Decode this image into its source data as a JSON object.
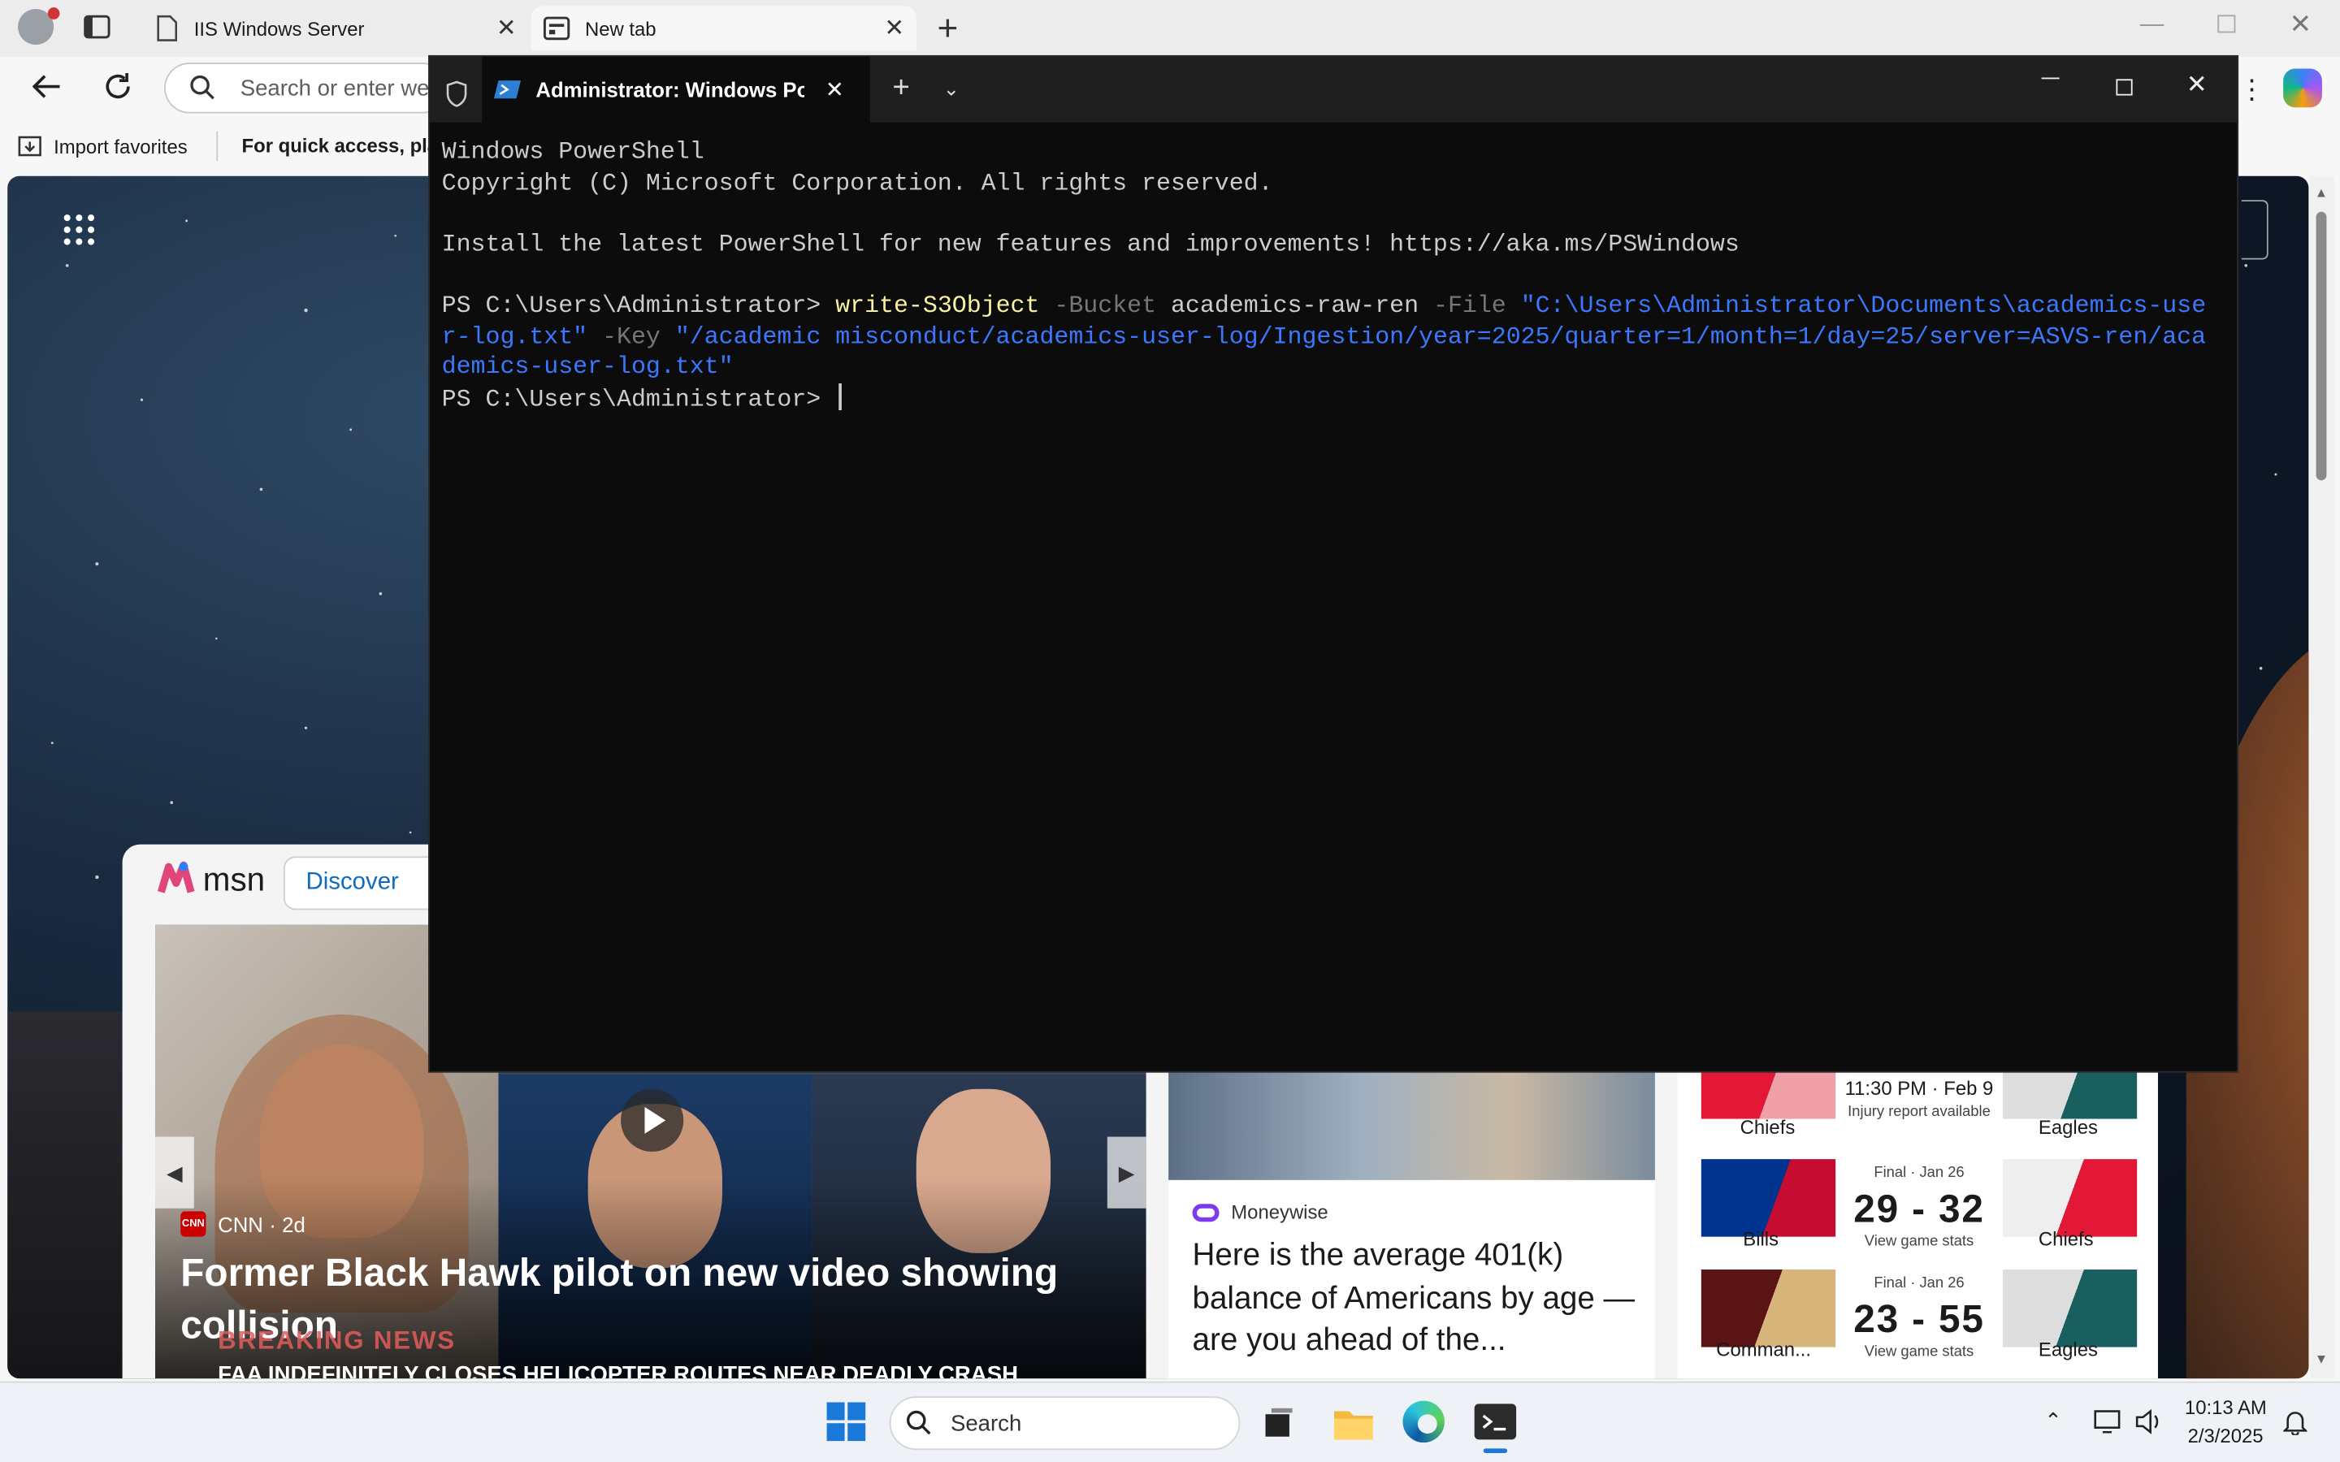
{
  "browser": {
    "tabs": [
      {
        "title": "IIS Windows Server"
      },
      {
        "title": "New tab"
      }
    ],
    "address_placeholder": "Search or enter web address",
    "favorites": {
      "import_label": "Import favorites",
      "tip": "For quick access, place your favorites here on the favorites bar."
    }
  },
  "msn": {
    "brand": "msn",
    "discover_label": "Discover",
    "main_story": {
      "source": "CNN",
      "age": "2d",
      "title": "Former Black Hawk pilot on new video showing collision",
      "banner": "BREAKING NEWS",
      "ticker": "FAA INDEFINITELY CLOSES HELICOPTER ROUTES NEAR DEADLY CRASH"
    },
    "side_story": {
      "source": "Moneywise",
      "title": "Here is the average 401(k) balance of Americans by age — are you ahead of the..."
    },
    "games": [
      {
        "left": "Chiefs",
        "right": "Eagles",
        "status": "11:30 PM · Feb 9",
        "detail": "Injury report available",
        "score": ""
      },
      {
        "left": "Bills",
        "right": "Chiefs",
        "status": "Final · Jan 26",
        "detail": "View game stats",
        "score": "29 - 32"
      },
      {
        "left": "Comman...",
        "right": "Eagles",
        "status": "Final · Jan 26",
        "detail": "View game stats",
        "score": "23 - 55"
      }
    ]
  },
  "terminal": {
    "tab_title": "Administrator: Windows Powe",
    "line1": "Windows PowerShell",
    "line2": "Copyright (C) Microsoft Corporation. All rights reserved.",
    "line3": "Install the latest PowerShell for new features and improvements! https://aka.ms/PSWindows",
    "prompt": "PS C:\\Users\\Administrator> ",
    "cmd": "write-S3Object",
    "p_bucket": " -Bucket ",
    "bucket": "academics-raw-ren",
    "p_file": " -File ",
    "file": "\"C:\\Users\\Administrator\\Documents\\academics-user-log.txt\"",
    "p_key": " -Key ",
    "key": "\"/academic misconduct/academics-user-log/Ingestion/year=2025/quarter=1/month=1/day=25/server=ASVS-ren/academics-user-log.txt\"",
    "prompt2": "PS C:\\Users\\Administrator> "
  },
  "taskbar": {
    "search_label": "Search",
    "time": "10:13 AM",
    "date": "2/3/2025"
  }
}
